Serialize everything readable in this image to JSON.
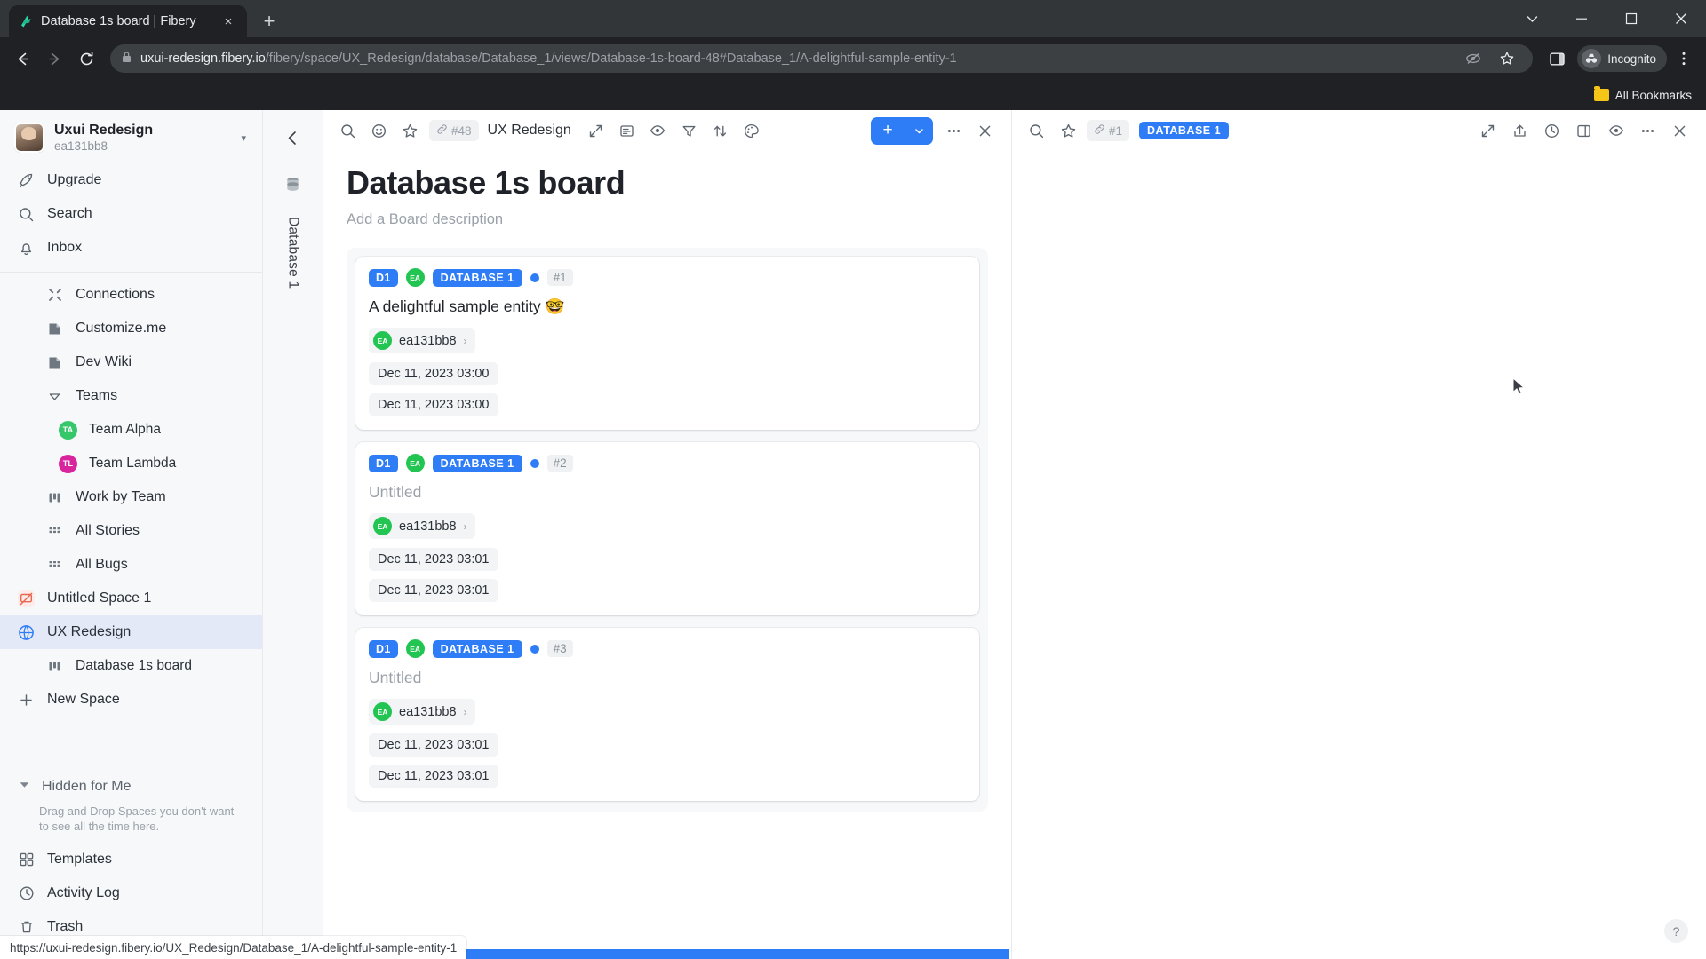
{
  "browser": {
    "tab": {
      "title": "Database 1s board | Fibery",
      "favicon": "fibery-logo-icon",
      "close_label": "×"
    },
    "new_tab_label": "+",
    "window_controls": {
      "minimize": "minimize-icon",
      "maximize": "maximize-icon",
      "close": "close-icon",
      "tab_search": "tab-search-icon"
    },
    "nav": {
      "back": "←",
      "forward": "→",
      "reload": "↻"
    },
    "omnibox": {
      "lock_icon": "lock-icon",
      "host": "uxui-redesign.fibery.io",
      "path": "/fibery/space/UX_Redesign/database/Database_1/views/Database-1s-board-48#Database_1/A-delightful-sample-entity-1",
      "full_url": "uxui-redesign.fibery.io/fibery/space/UX_Redesign/database/Database_1/views/Database-1s-board-48#Database_1/A-delightful-sample-entity-1",
      "third_party_cookies_icon": "eye-slash-icon",
      "bookmark_icon": "star-icon",
      "side_panel_icon": "side-panel-icon",
      "menu_icon": "kebab-menu-icon"
    },
    "profile": {
      "name": "Incognito",
      "icon": "incognito-icon"
    },
    "bookmarks_bar": {
      "label": "All Bookmarks",
      "icon": "folder-icon"
    },
    "status_url": "https://uxui-redesign.fibery.io/UX_Redesign/Database_1/A-delightful-sample-entity-1"
  },
  "sidebar": {
    "workspace": {
      "name": "Uxui Redesign",
      "account": "ea131bb8",
      "caret": "▾",
      "avatar": "user-avatar"
    },
    "top_items": [
      {
        "label": "Upgrade",
        "icon": "rocket-icon"
      },
      {
        "label": "Search",
        "icon": "search-icon"
      },
      {
        "label": "Inbox",
        "icon": "bell-icon"
      }
    ],
    "spaces": [
      {
        "label": "Connections",
        "icon": "connections-icon",
        "indent": 1
      },
      {
        "label": "Customize.me",
        "icon": "document-icon",
        "indent": 1
      },
      {
        "label": "Dev Wiki",
        "icon": "document-icon",
        "indent": 1
      },
      {
        "label": "Teams",
        "icon": "collapse-triangle-icon",
        "indent": 1
      },
      {
        "label": "Team Alpha",
        "icon": "avatar-ta",
        "initials": "TA",
        "color": "#36c76b",
        "indent": 2
      },
      {
        "label": "Team Lambda",
        "icon": "avatar-tl",
        "initials": "TL",
        "color": "#d8259e",
        "indent": 2
      },
      {
        "label": "Work by Team",
        "icon": "board-icon",
        "indent": 1
      },
      {
        "label": "All Stories",
        "icon": "grid-icon",
        "indent": 1
      },
      {
        "label": "All Bugs",
        "icon": "grid-icon",
        "indent": 1
      },
      {
        "label": "Untitled Space 1",
        "icon": "space-icon-red",
        "indent": 0
      },
      {
        "label": "UX Redesign",
        "icon": "space-icon-blue",
        "indent": 0,
        "active": true
      },
      {
        "label": "Database 1s board",
        "icon": "board-icon",
        "indent": 1
      },
      {
        "label": "New Space",
        "icon": "plus-icon",
        "indent": 0
      }
    ],
    "hidden": {
      "label": "Hidden for Me",
      "caret": "▾",
      "description": "Drag and Drop Spaces you don't want to see all the time here."
    },
    "bottom_items": [
      {
        "label": "Templates",
        "icon": "templates-icon"
      },
      {
        "label": "Activity Log",
        "icon": "clock-icon"
      },
      {
        "label": "Trash",
        "icon": "trash-icon"
      }
    ]
  },
  "rail": {
    "back_icon": "arrow-left-icon",
    "database_icon": "database-icon",
    "vertical_label": "Database 1"
  },
  "board": {
    "toolbar": {
      "search_icon": "search-icon",
      "emoji_icon": "emoji-icon",
      "star_icon": "star-icon",
      "link_chip": {
        "icon": "link-icon",
        "label": "#48"
      },
      "space_name": "UX Redesign",
      "expand_icon": "expand-icon",
      "description_icon": "description-icon",
      "view_icon": "eye-icon",
      "filter_icon": "filter-icon",
      "sort_icon": "sort-icon",
      "color_icon": "palette-icon",
      "add_label": "+",
      "add_caret": "▾",
      "more_icon": "more-icon",
      "close_icon": "close-icon"
    },
    "title": "Database 1s board",
    "description_placeholder": "Add a Board description",
    "cards": [
      {
        "tag": "D1",
        "avatar_initials": "EA",
        "database": "DATABASE 1",
        "dot_color": "#2f7df6",
        "number": "#1",
        "title": "A delightful sample entity 🤓",
        "owner": "ea131bb8",
        "owner_initials": "EA",
        "owner_chevron": "›",
        "dates": [
          "Dec 11, 2023 03:00",
          "Dec 11, 2023 03:00"
        ]
      },
      {
        "tag": "D1",
        "avatar_initials": "EA",
        "database": "DATABASE 1",
        "dot_color": "#2f7df6",
        "number": "#2",
        "title": "Untitled",
        "title_empty": true,
        "owner": "ea131bb8",
        "owner_initials": "EA",
        "owner_chevron": "›",
        "dates": [
          "Dec 11, 2023 03:01",
          "Dec 11, 2023 03:01"
        ]
      },
      {
        "tag": "D1",
        "avatar_initials": "EA",
        "database": "DATABASE 1",
        "dot_color": "#2f7df6",
        "number": "#3",
        "title": "Untitled",
        "title_empty": true,
        "owner": "ea131bb8",
        "owner_initials": "EA",
        "owner_chevron": "›",
        "dates": [
          "Dec 11, 2023 03:01",
          "Dec 11, 2023 03:01"
        ]
      }
    ]
  },
  "detail_panel": {
    "toolbar": {
      "search_icon": "search-icon",
      "star_icon": "star-icon",
      "link_chip": {
        "icon": "link-icon",
        "label": "#1"
      },
      "database_badge": "DATABASE 1",
      "expand_icon": "expand-icon",
      "share_icon": "share-icon",
      "history_icon": "history-icon",
      "layout_icon": "layout-icon",
      "view_icon": "eye-icon",
      "more_icon": "more-icon",
      "close_icon": "close-icon"
    },
    "help_label": "?"
  },
  "colors": {
    "accent": "#2f7df6",
    "sidebar_bg": "#f7f8f9",
    "chrome_bg": "#202124",
    "active_item": "#e4e9f7"
  }
}
